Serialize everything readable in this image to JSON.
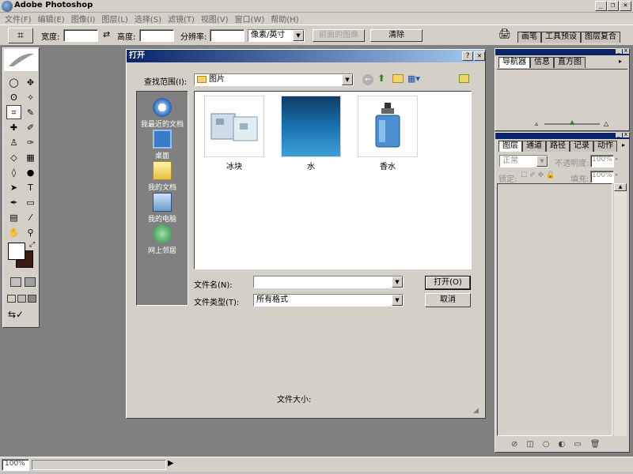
{
  "app": {
    "title": "Adobe Photoshop",
    "win_min": "_",
    "win_restore": "❐",
    "win_close": "✕"
  },
  "menu": [
    "文件(F)",
    "编辑(E)",
    "图像(I)",
    "图层(L)",
    "选择(S)",
    "滤镜(T)",
    "视图(V)",
    "窗口(W)",
    "帮助(H)"
  ],
  "options": {
    "width_label": "宽度:",
    "height_label": "高度:",
    "resolution_label": "分辨率:",
    "units_value": "像素/英寸",
    "front_image_button": "前面的图像",
    "clear_button": "清除",
    "palette_tabs": [
      "画笔",
      "工具预设",
      "图层复合"
    ]
  },
  "panels": {
    "navigator_tabs": [
      "导航器",
      "信息",
      "直方图"
    ],
    "layers_tabs": [
      "图层",
      "通道",
      "路径",
      "记录",
      "动作"
    ],
    "blend_mode": "正常",
    "opacity_label": "不透明度:",
    "opacity_value": "100%",
    "lock_label": "锁定:",
    "fill_label": "填充:",
    "fill_value": "100%"
  },
  "status": {
    "zoom": "100%"
  },
  "dialog": {
    "title": "打开",
    "help": "?",
    "close": "✕",
    "look_in_label": "查找范围(I):",
    "look_in_value": "图片",
    "places": [
      "我最近的文档",
      "桌面",
      "我的文档",
      "我的电脑",
      "网上邻居"
    ],
    "files": [
      "冰块",
      "水",
      "香水"
    ],
    "filename_label": "文件名(N):",
    "filename_value": "",
    "filetype_label": "文件类型(T):",
    "filetype_value": "所有格式",
    "open_button": "打开(O)",
    "cancel_button": "取消",
    "file_size_label": "文件大小:"
  },
  "colors": {
    "title_gradient_start": "#0a246a",
    "title_gradient_end": "#a6caf0",
    "chrome": "#d4d0c8",
    "workspace": "#808080"
  }
}
